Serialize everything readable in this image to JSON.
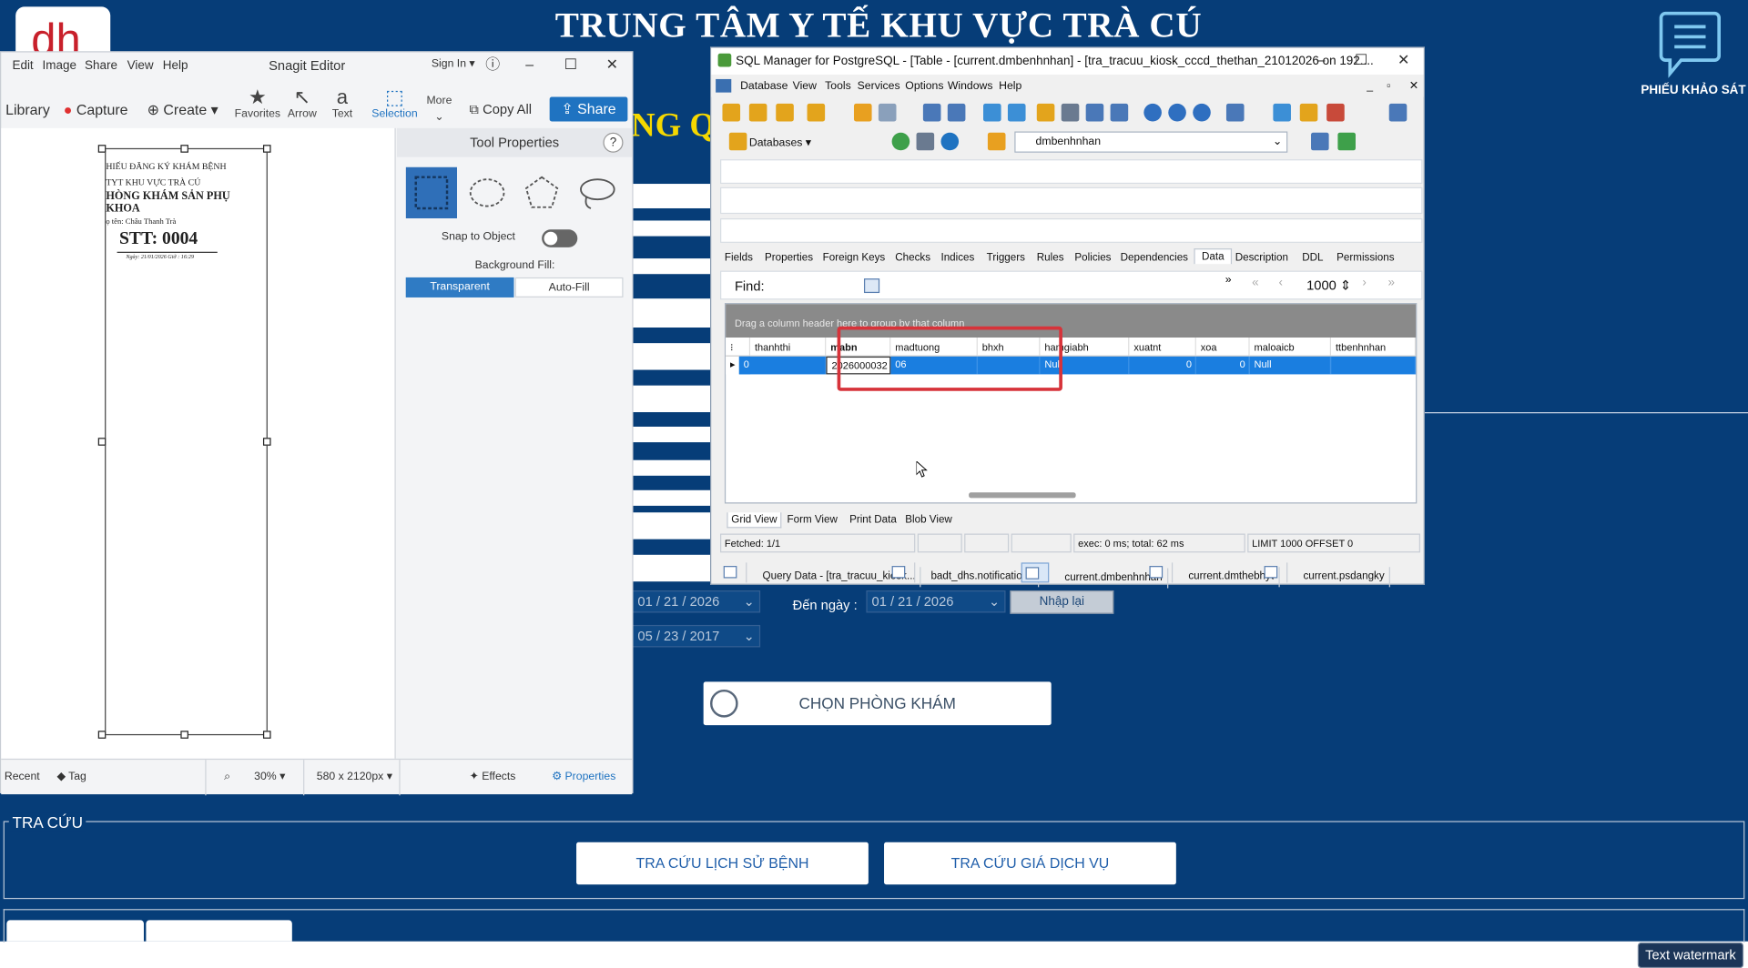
{
  "page": {
    "title": "TRUNG TÂM Y TẾ KHU VỰC TRÀ CÚ",
    "subtitle_fragment": "NG Q",
    "survey_label": "PHIẾU KHẢO SÁT",
    "date_from": "01 / 21 / 2026",
    "den_ngay_label": "Đến ngày :",
    "date_to": "01 / 21 / 2026",
    "date_dob": "05 / 23 / 2017",
    "nhap_lai": "Nhập lại",
    "chon_phong_kham": "CHỌN PHÒNG KHÁM",
    "tra_cuu_legend": "TRA CỨU",
    "tra_cuu_lich_su": "TRA CỨU LỊCH SỬ BỆNH",
    "tra_cuu_gia": "TRA CỨU GIÁ DỊCH VỤ",
    "watermark": "Text watermark",
    "colors": {
      "background": "#063d78",
      "title": "#ffffff",
      "subtitle": "#f5d800"
    }
  },
  "snagit": {
    "menu": [
      "Edit",
      "Image",
      "Share",
      "View",
      "Help"
    ],
    "title": "Snagit Editor",
    "sign_in": "Sign In",
    "library": "Library",
    "capture": "Capture",
    "create": "Create",
    "tools": [
      {
        "label": "Favorites",
        "icon": "star-icon"
      },
      {
        "label": "Arrow",
        "icon": "arrow-icon"
      },
      {
        "label": "Text",
        "icon": "text-icon"
      },
      {
        "label": "Selection",
        "icon": "selection-icon"
      },
      {
        "label": "More",
        "icon": "more-icon"
      }
    ],
    "copy_all": "Copy All",
    "share": "Share",
    "tool_properties": "Tool Properties",
    "snap_to_object": "Snap to Object",
    "background_fill": "Background Fill:",
    "transparent": "Transparent",
    "auto_fill": "Auto-Fill",
    "receipt": {
      "line1": "HIẾU ĐĂNG KÝ KHÁM BỆNH",
      "line2": "TYT KHU VỰC TRÀ CÚ",
      "line3": "HÒNG KHÁM SẢN PHỤ",
      "line4": "KHOA",
      "line5": "ọ tên: Châu Thanh Trà",
      "stt": "STT: 0004",
      "datetime": "Ngày: 21/01/2026       Giờ : 16:29"
    },
    "status": {
      "recent": "Recent",
      "tag": "Tag",
      "zoom": "30%",
      "size": "580 x 2120px",
      "effects": "Effects",
      "properties": "Properties"
    }
  },
  "sql": {
    "title": "SQL Manager for PostgreSQL - [Table - [current.dmbenhnhan] - [tra_tracuu_kiosk_cccd_thethan_21012026 on 192....",
    "menu": [
      "Database",
      "View",
      "Tools",
      "Services",
      "Options",
      "Windows",
      "Help"
    ],
    "databases_label": "Databases",
    "db_selected": "dmbenhnhan",
    "tabs": [
      "Fields",
      "Properties",
      "Foreign Keys",
      "Checks",
      "Indices",
      "Triggers",
      "Rules",
      "Policies",
      "Dependencies",
      "Data",
      "Description",
      "DDL",
      "Permissions"
    ],
    "active_tab": "Data",
    "find_label": "Find:",
    "limit_value": "1000",
    "group_hint": "Drag a column header here to group by that column",
    "columns": [
      "thanhthi",
      "mabn",
      "madtuong",
      "bhxh",
      "hamgiabh",
      "xuatnt",
      "xoa",
      "maloaicb",
      "ttbenhnhan"
    ],
    "row": [
      "0",
      "2026000032",
      "06",
      "",
      "Null",
      "0",
      "0",
      "Null",
      ""
    ],
    "views": [
      "Grid View",
      "Form View",
      "Print Data",
      "Blob View"
    ],
    "status": {
      "fetched": "Fetched: 1/1",
      "exec": "exec: 0 ms; total: 62 ms",
      "limit": "LIMIT 1000 OFFSET 0"
    },
    "bottom_tabs": [
      "Query Data - [tra_tracuu_kiosk...",
      "badt_dhs.notifications",
      "current.dmbenhnhan",
      "current.dmthebhyt",
      "current.psdangky"
    ],
    "active_bottom_tab": "current.dmbenhnhan"
  }
}
